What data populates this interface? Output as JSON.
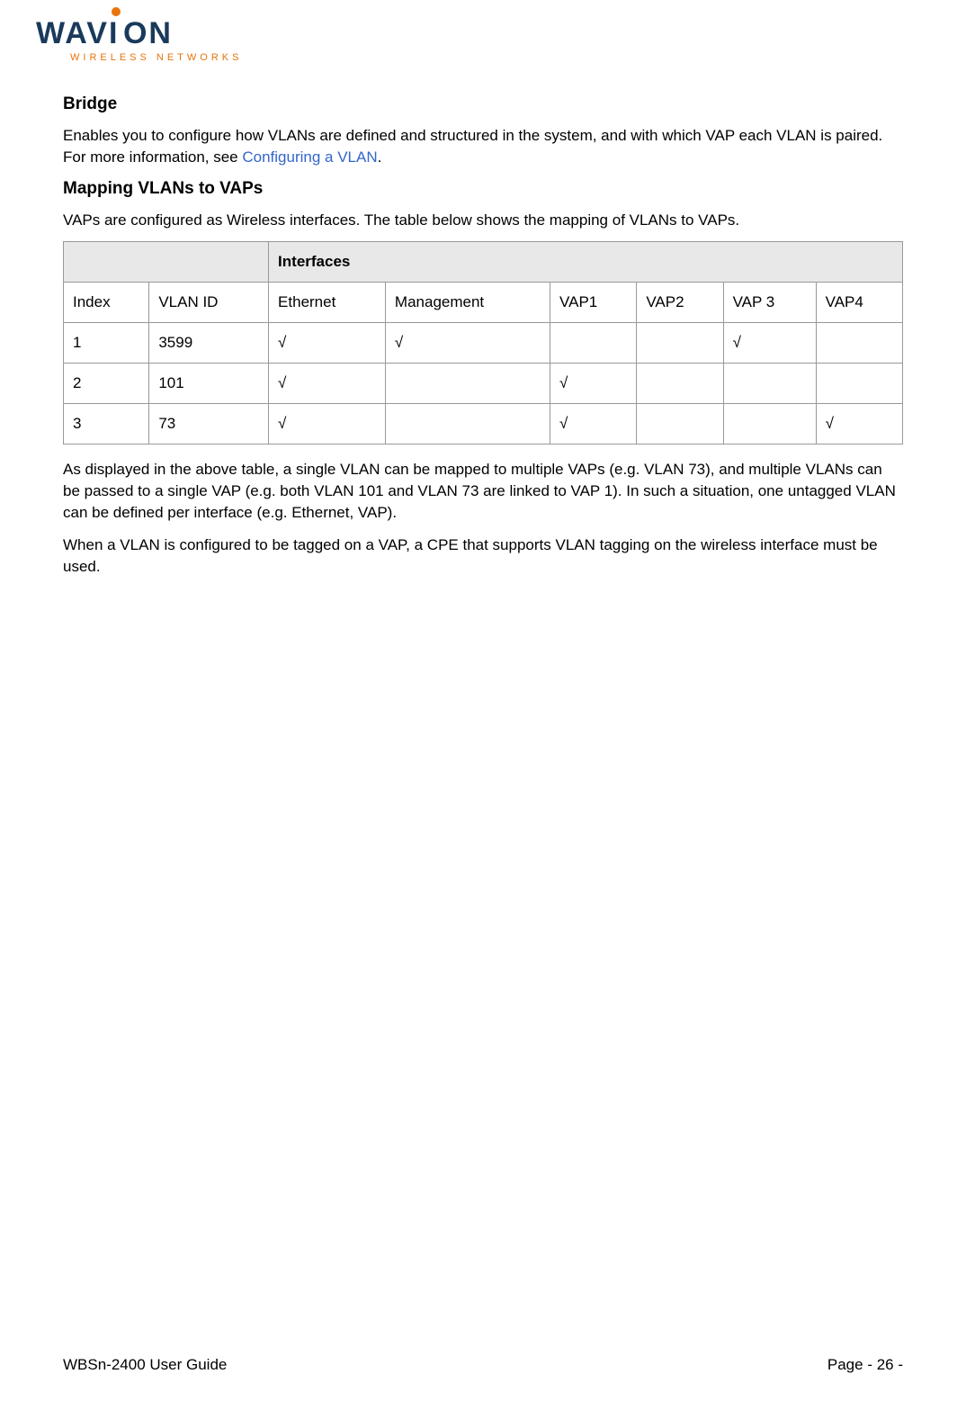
{
  "logo": {
    "brand_pre": "WAV",
    "brand_i": "I",
    "brand_post": "ON",
    "tagline": "WIRELESS NETWORKS"
  },
  "sections": {
    "bridge_title": "Bridge",
    "bridge_text_pre": "Enables you to configure how VLANs are defined and structured in the system, and with which VAP each VLAN is paired. For more information, see ",
    "bridge_link": "Configuring a VLAN",
    "bridge_text_post": ".",
    "mapping_title": "Mapping VLANs to VAPs",
    "mapping_intro": "VAPs are configured as Wireless interfaces. The table below shows the mapping of VLANs to VAPs.",
    "after_table_p1": "As displayed in the above table, a single VLAN can be mapped to multiple VAPs (e.g. VLAN 73), and multiple VLANs can be passed to a single VAP (e.g. both VLAN 101 and VLAN 73 are linked to VAP 1). In such a situation, one untagged VLAN can be defined per interface (e.g. Ethernet, VAP).",
    "after_table_p2": "When a VLAN is configured to be tagged on a VAP, a CPE that supports VLAN tagging on the wireless interface must be used."
  },
  "table": {
    "group_header": "Interfaces",
    "columns": {
      "c0": "Index",
      "c1": "VLAN ID",
      "c2": "Ethernet",
      "c3": "Management",
      "c4": "VAP1",
      "c5": "VAP2",
      "c6": "VAP 3",
      "c7": "VAP4"
    },
    "check": "√",
    "rows": [
      {
        "index": "1",
        "vlan": "3599",
        "eth": true,
        "mgmt": true,
        "vap1": false,
        "vap2": false,
        "vap3": true,
        "vap4": false
      },
      {
        "index": "2",
        "vlan": "101",
        "eth": true,
        "mgmt": false,
        "vap1": true,
        "vap2": false,
        "vap3": false,
        "vap4": false
      },
      {
        "index": "3",
        "vlan": "73",
        "eth": true,
        "mgmt": false,
        "vap1": true,
        "vap2": false,
        "vap3": false,
        "vap4": true
      }
    ]
  },
  "footer": {
    "left": "WBSn-2400 User Guide",
    "right": "Page - 26 -"
  }
}
